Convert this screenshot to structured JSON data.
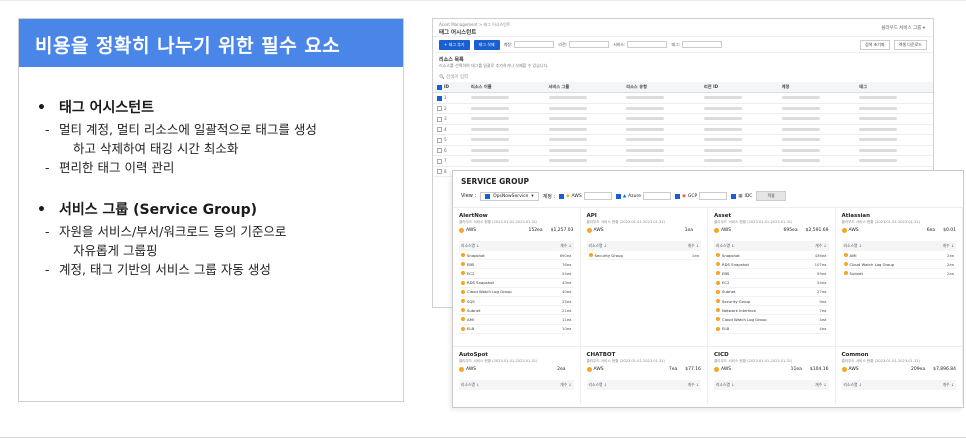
{
  "slide": {
    "title": "비용을 정확히 나누기 위한 필수 요소",
    "bullets": [
      {
        "heading": "태그 어시스턴트",
        "items": [
          {
            "line1": "멀티 계정, 멀티 리소스에 일괄적으로 태그를 생성",
            "line2": "하고 삭제하여 태깅 시간 최소화"
          },
          {
            "line1": "편리한 태그 이력 관리",
            "line2": ""
          }
        ]
      },
      {
        "heading": "서비스 그룹 (Service Group)",
        "items": [
          {
            "line1": "자원을 서비스/부서/워크로드 등의 기준으로",
            "line2": "자유롭게 그룹핑"
          },
          {
            "line1": "계정, 태그 기반의 서비스 그룹 자동 생성",
            "line2": ""
          }
        ]
      }
    ]
  },
  "tag_assistant": {
    "breadcrumb": "Asset Management > 태그 어시스턴트",
    "page_title": "태그 어시스턴트",
    "user": "클라우드 서비스 그룹 ▾",
    "btn_add": "+ 태그 추가",
    "btn_delete": "태그 삭제",
    "filters": [
      "계정:",
      "리전:",
      "서비스:",
      "태그:"
    ],
    "btn_reset": "검색 초기화",
    "btn_export": "엑셀 다운로드",
    "list_title": "리소스 목록",
    "list_sub": "리소스를 선택하여 태그를 일괄로 추가하거나 삭제할 수 있습니다.",
    "search_placeholder": "검색어 입력",
    "columns": [
      "ID",
      "리소스 이름",
      "서비스 그룹",
      "리소스 유형",
      "리전 ID",
      "계정",
      "태그"
    ],
    "row_numbers": [
      "1",
      "2",
      "3",
      "4",
      "5",
      "6",
      "7",
      "8"
    ]
  },
  "service_group": {
    "title": "SERVICE GROUP",
    "view_label": "View :",
    "view_value": "OpsNowService",
    "provider_label": "계정 :",
    "providers": [
      "AWS",
      "Azure",
      "GCP",
      "IDC"
    ],
    "apply": "적용",
    "col_resource": "리소스명 ↓",
    "col_count": "개수 ↓",
    "cards": [
      {
        "name": "AlertNow",
        "desc": "클라우드 서비스 현황 (2023.01.01-2023.01.31)",
        "provider": "AWS",
        "count": "152ea",
        "cost": "$1,257.03",
        "rows": [
          [
            "Snapshot",
            "690ea"
          ],
          [
            "EBS",
            "76ea"
          ],
          [
            "EC2",
            "54ea"
          ],
          [
            "RDS Snapshot",
            "43ea"
          ],
          [
            "Cloud Watch Log Group",
            "40ea"
          ],
          [
            "SQS",
            "25ea"
          ],
          [
            "Subnet",
            "21ea"
          ],
          [
            "AMI",
            "11ea"
          ],
          [
            "ELB",
            "10ea"
          ]
        ]
      },
      {
        "name": "API",
        "desc": "클라우드 서비스 현황 (2023.01.01-2023.01.31)",
        "provider": "AWS",
        "count": "1ea",
        "cost": "",
        "rows": [
          [
            "Security Group",
            "1ea"
          ]
        ]
      },
      {
        "name": "Asset",
        "desc": "클라우드 서비스 현황 (2023.01.01-2023.01.31)",
        "provider": "AWS",
        "count": "695ea",
        "cost": "$2,591.69",
        "rows": [
          [
            "Snapshot",
            "436ea"
          ],
          [
            "RDS Snapshot",
            "107ea"
          ],
          [
            "EBS",
            "59ea"
          ],
          [
            "EC2",
            "54ea"
          ],
          [
            "Subnet",
            "27ea"
          ],
          [
            "Security Group",
            "9ea"
          ],
          [
            "Network Interface",
            "7ea"
          ],
          [
            "Cloud Watch Log Group",
            "4ea"
          ],
          [
            "ELB",
            "4ea"
          ]
        ]
      },
      {
        "name": "Atlassian",
        "desc": "클라우드 서비스 현황 (2023.01.01-2023.01.31)",
        "provider": "AWS",
        "count": "6ea",
        "cost": "$0.01",
        "rows": [
          [
            "AMI",
            "2ea"
          ],
          [
            "Cloud Watch Log Group",
            "2ea"
          ],
          [
            "Subnet",
            "2ea"
          ]
        ]
      },
      {
        "name": "AutoSpot",
        "desc": "클라우드 서비스 현황 (2023.01.01-2023.01.31)",
        "provider": "AWS",
        "count": "2ea",
        "cost": "",
        "rows": []
      },
      {
        "name": "CHATBOT",
        "desc": "클라우드 서비스 현황 (2023.01.01-2023.01.31)",
        "provider": "AWS",
        "count": "7ea",
        "cost": "$77.16",
        "rows": []
      },
      {
        "name": "CICD",
        "desc": "클라우드 서비스 현황 (2023.01.01-2023.01.31)",
        "provider": "AWS",
        "count": "11ea",
        "cost": "$104.16",
        "rows": []
      },
      {
        "name": "Common",
        "desc": "클라우드 서비스 현황 (2023.01.01-2023.01.31)",
        "provider": "AWS",
        "count": "209ea",
        "cost": "$7,896.84",
        "rows": []
      }
    ]
  },
  "colors": {
    "title_bar": "#4a86e8",
    "primary_button": "#1a5fd1",
    "aws": "#f5a623"
  }
}
